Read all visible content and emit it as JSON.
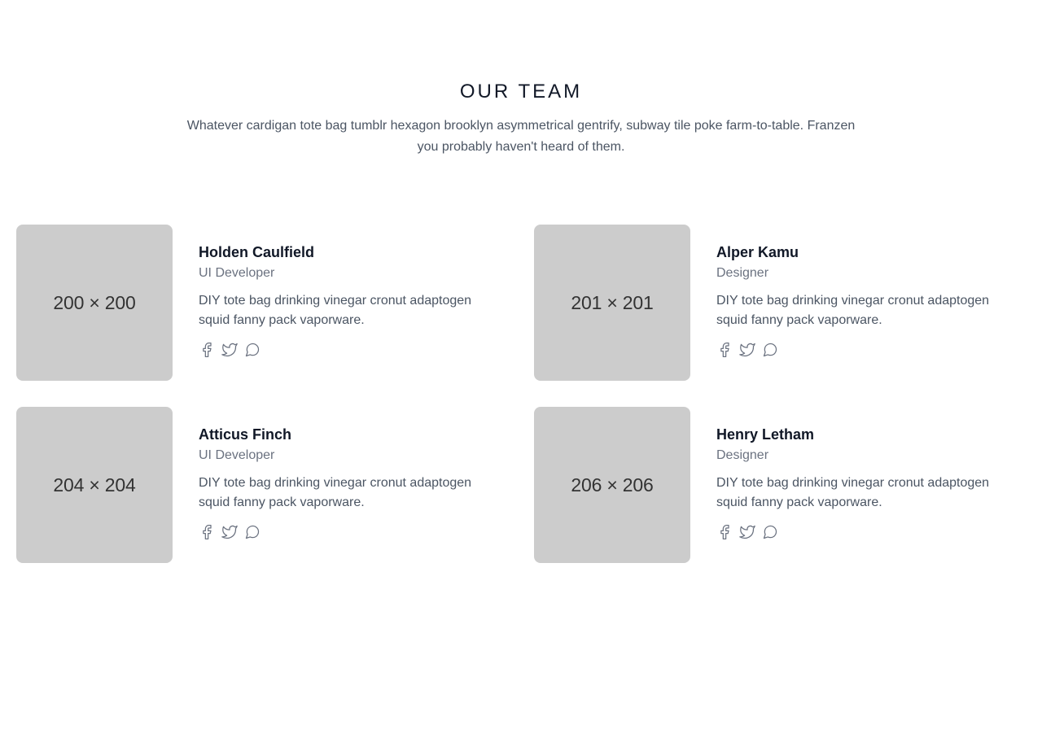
{
  "header": {
    "title": "OUR TEAM",
    "subtitle": "Whatever cardigan tote bag tumblr hexagon brooklyn asymmetrical gentrify, subway tile poke farm-to-table. Franzen you probably haven't heard of them."
  },
  "team": [
    {
      "avatar": "200 × 200",
      "name": "Holden Caulfield",
      "role": "UI Developer",
      "bio": "DIY tote bag drinking vinegar cronut adaptogen squid fanny pack vaporware."
    },
    {
      "avatar": "201 × 201",
      "name": "Alper Kamu",
      "role": "Designer",
      "bio": "DIY tote bag drinking vinegar cronut adaptogen squid fanny pack vaporware."
    },
    {
      "avatar": "204 × 204",
      "name": "Atticus Finch",
      "role": "UI Developer",
      "bio": "DIY tote bag drinking vinegar cronut adaptogen squid fanny pack vaporware."
    },
    {
      "avatar": "206 × 206",
      "name": "Henry Letham",
      "role": "Designer",
      "bio": "DIY tote bag drinking vinegar cronut adaptogen squid fanny pack vaporware."
    }
  ],
  "icons": {
    "social": [
      "facebook-icon",
      "twitter-icon",
      "chat-icon"
    ],
    "color": "#6b7280"
  }
}
